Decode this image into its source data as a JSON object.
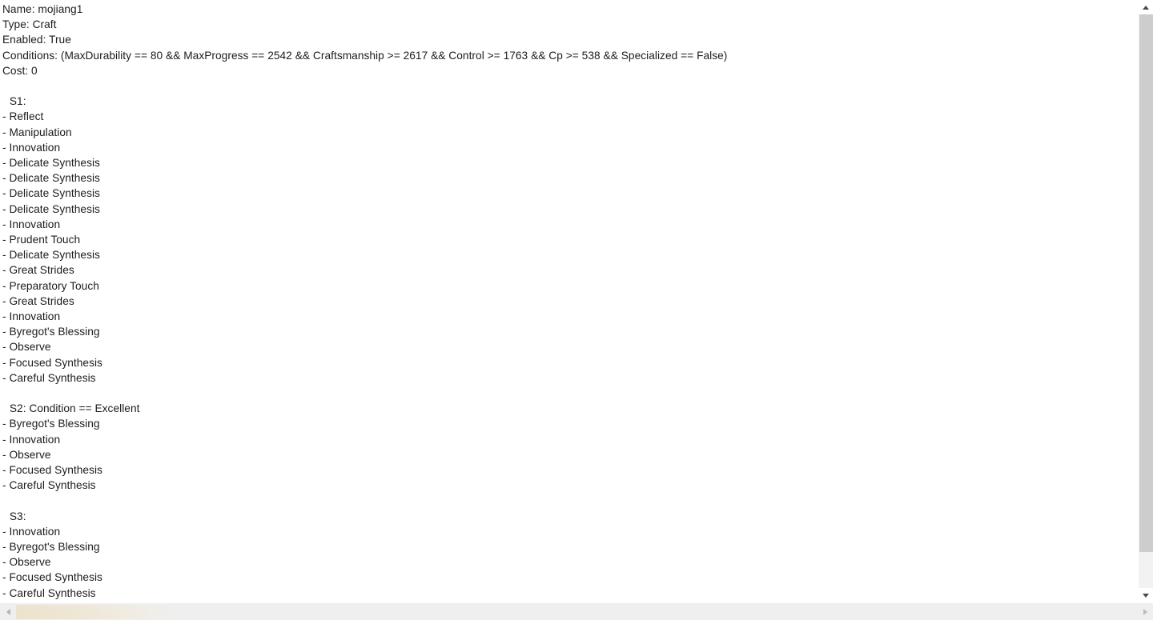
{
  "document": {
    "header": [
      "Name: mojiang1",
      "Type: Craft",
      "Enabled: True",
      "Conditions: (MaxDurability == 80 && MaxProgress == 2542 && Craftsmanship >= 2617 && Control >= 1763 && Cp >= 538 && Specialized == False)",
      "Cost: 0"
    ],
    "sections": [
      {
        "heading": " S1:",
        "steps": [
          "- Reflect",
          "- Manipulation",
          "- Innovation",
          "- Delicate Synthesis",
          "- Delicate Synthesis",
          "- Delicate Synthesis",
          "- Delicate Synthesis",
          "- Innovation",
          "- Prudent Touch",
          "- Delicate Synthesis",
          "- Great Strides",
          "- Preparatory Touch",
          "- Great Strides",
          "- Innovation",
          "- Byregot's Blessing",
          "- Observe",
          "- Focused Synthesis",
          "- Careful Synthesis"
        ]
      },
      {
        "heading": " S2: Condition == Excellent",
        "steps": [
          "- Byregot's Blessing",
          "- Innovation",
          "- Observe",
          "- Focused Synthesis",
          "- Careful Synthesis"
        ]
      },
      {
        "heading": " S3:",
        "steps": [
          "- Innovation",
          "- Byregot's Blessing",
          "- Observe",
          "- Focused Synthesis",
          "- Careful Synthesis"
        ]
      }
    ]
  },
  "scrollbars": {
    "vertical": {
      "up_arrow": "chevron-up-icon",
      "down_arrow": "chevron-down-icon",
      "thumb_color": "#cdcdcd",
      "track_color": "#f2f2f2"
    },
    "horizontal": {
      "left_arrow": "chevron-left-icon",
      "right_arrow": "chevron-right-icon",
      "thumb_color": "#ece3cc",
      "track_color": "#efefef"
    }
  },
  "colors": {
    "background": "#ffffff",
    "text": "#1c1c1c"
  }
}
